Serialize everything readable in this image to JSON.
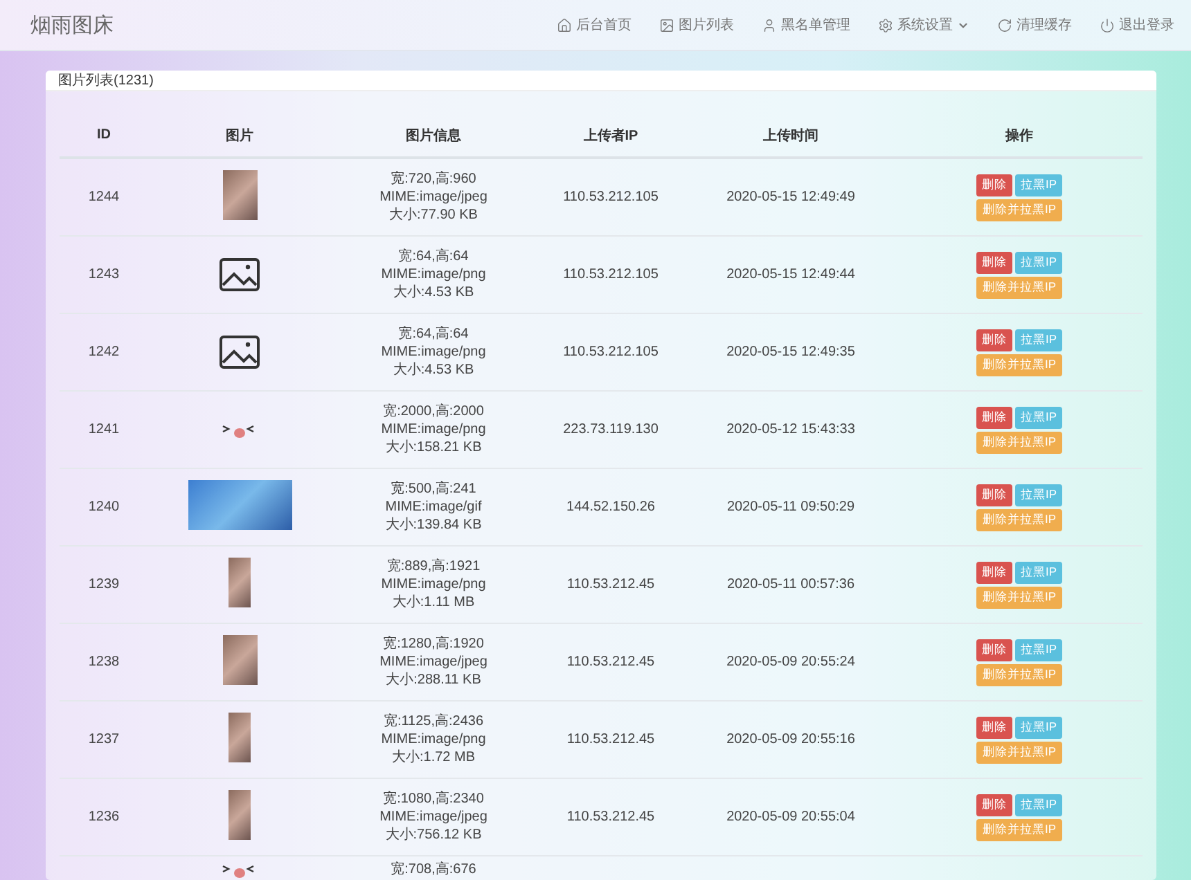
{
  "navbar": {
    "brand": "烟雨图床",
    "items": [
      {
        "label": "后台首页",
        "has_menu": false
      },
      {
        "label": "图片列表",
        "has_menu": false
      },
      {
        "label": "黑名单管理",
        "has_menu": false
      },
      {
        "label": "系统设置",
        "has_menu": true
      },
      {
        "label": "清理缓存",
        "has_menu": false
      },
      {
        "label": "退出登录",
        "has_menu": false
      }
    ]
  },
  "panel": {
    "title": "图片列表(1231)",
    "table": {
      "columns": [
        "ID",
        "图片",
        "图片信息",
        "上传者IP",
        "上传时间",
        "操作"
      ],
      "rows": [
        {
          "id": "1244",
          "thumb": {
            "kind": "portrait"
          },
          "info": [
            "宽:720,高:960",
            "MIME:image/jpeg",
            "大小:77.90 KB"
          ],
          "ip": "110.53.212.105",
          "time": "2020-05-15 12:49:49",
          "actions": [
            "删除",
            "拉黑IP",
            "删除并拉黑IP"
          ]
        },
        {
          "id": "1243",
          "thumb": {
            "kind": "icon"
          },
          "info": [
            "宽:64,高:64",
            "MIME:image/png",
            "大小:4.53 KB"
          ],
          "ip": "110.53.212.105",
          "time": "2020-05-15 12:49:44",
          "actions": [
            "删除",
            "拉黑IP",
            "删除并拉黑IP"
          ]
        },
        {
          "id": "1242",
          "thumb": {
            "kind": "icon"
          },
          "info": [
            "宽:64,高:64",
            "MIME:image/png",
            "大小:4.53 KB"
          ],
          "ip": "110.53.212.105",
          "time": "2020-05-15 12:49:35",
          "actions": [
            "删除",
            "拉黑IP",
            "删除并拉黑IP"
          ]
        },
        {
          "id": "1241",
          "thumb": {
            "kind": "sticker"
          },
          "info": [
            "宽:2000,高:2000",
            "MIME:image/png",
            "大小:158.21 KB"
          ],
          "ip": "223.73.119.130",
          "time": "2020-05-12 15:43:33",
          "actions": [
            "删除",
            "拉黑IP",
            "删除并拉黑IP"
          ]
        },
        {
          "id": "1240",
          "thumb": {
            "kind": "banner"
          },
          "info": [
            "宽:500,高:241",
            "MIME:image/gif",
            "大小:139.84 KB"
          ],
          "ip": "144.52.150.26",
          "time": "2020-05-11 09:50:29",
          "actions": [
            "删除",
            "拉黑IP",
            "删除并拉黑IP"
          ]
        },
        {
          "id": "1239",
          "thumb": {
            "kind": "strip"
          },
          "info": [
            "宽:889,高:1921",
            "MIME:image/png",
            "大小:1.11 MB"
          ],
          "ip": "110.53.212.45",
          "time": "2020-05-11 00:57:36",
          "actions": [
            "删除",
            "拉黑IP",
            "删除并拉黑IP"
          ]
        },
        {
          "id": "1238",
          "thumb": {
            "kind": "portrait"
          },
          "info": [
            "宽:1280,高:1920",
            "MIME:image/jpeg",
            "大小:288.11 KB"
          ],
          "ip": "110.53.212.45",
          "time": "2020-05-09 20:55:24",
          "actions": [
            "删除",
            "拉黑IP",
            "删除并拉黑IP"
          ]
        },
        {
          "id": "1237",
          "thumb": {
            "kind": "strip"
          },
          "info": [
            "宽:1125,高:2436",
            "MIME:image/png",
            "大小:1.72 MB"
          ],
          "ip": "110.53.212.45",
          "time": "2020-05-09 20:55:16",
          "actions": [
            "删除",
            "拉黑IP",
            "删除并拉黑IP"
          ]
        },
        {
          "id": "1236",
          "thumb": {
            "kind": "strip"
          },
          "info": [
            "宽:1080,高:2340",
            "MIME:image/jpeg",
            "大小:756.12 KB"
          ],
          "ip": "110.53.212.45",
          "time": "2020-05-09 20:55:04",
          "actions": [
            "删除",
            "拉黑IP",
            "删除并拉黑IP"
          ]
        },
        {
          "thumb": {
            "kind": "sticker"
          },
          "info": [
            "宽:708,高:676"
          ]
        }
      ]
    }
  }
}
